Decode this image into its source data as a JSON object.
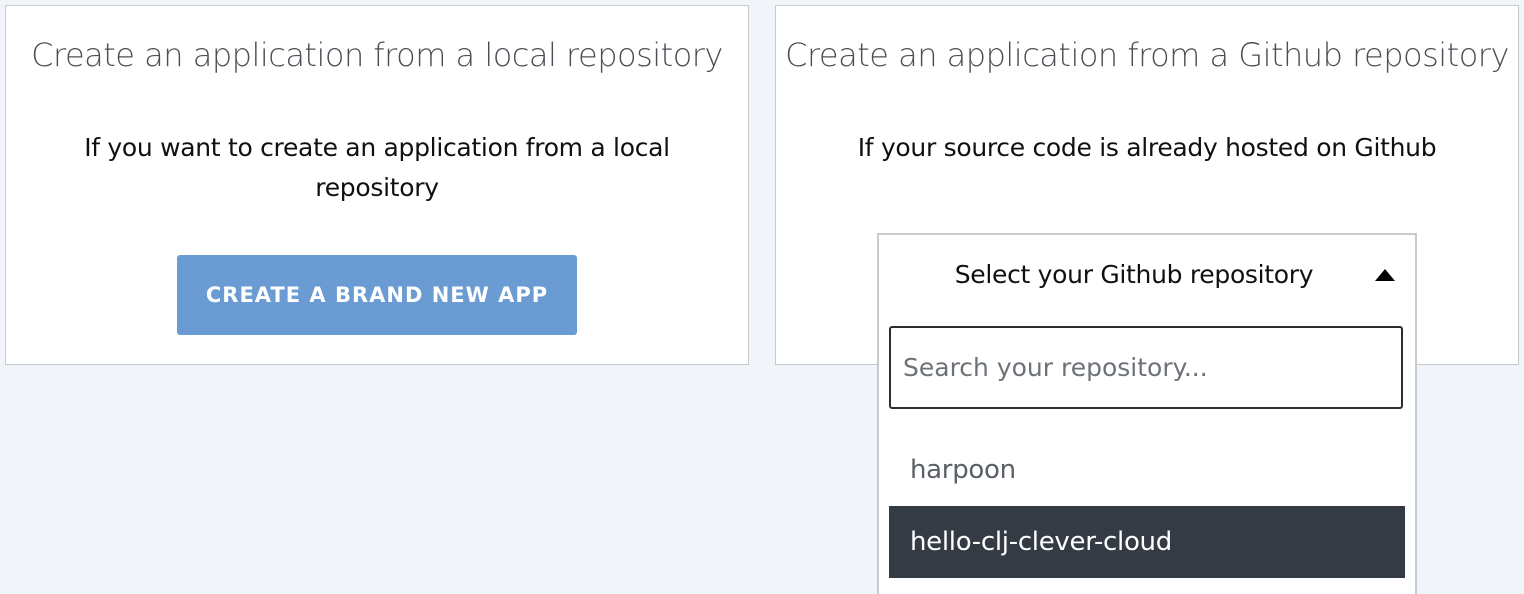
{
  "local_card": {
    "title": "Create an application from a local repository",
    "description": "If you want to create an application from a local repository",
    "button_label": "CREATE A BRAND NEW APP"
  },
  "github_card": {
    "title": "Create an application from a Github repository",
    "description": "If your source code is already hosted on Github",
    "select_label": "Select your Github repository",
    "search_placeholder": "Search your repository...",
    "repositories": [
      {
        "name": "harpoon",
        "highlighted": false
      },
      {
        "name": "hello-clj-clever-cloud",
        "highlighted": true
      }
    ]
  },
  "colors": {
    "page_background": "#f1f4f8",
    "button_background": "#6b9bd3",
    "highlight_background": "#343b45"
  },
  "icons": {
    "select_caret": "caret-up-icon"
  }
}
